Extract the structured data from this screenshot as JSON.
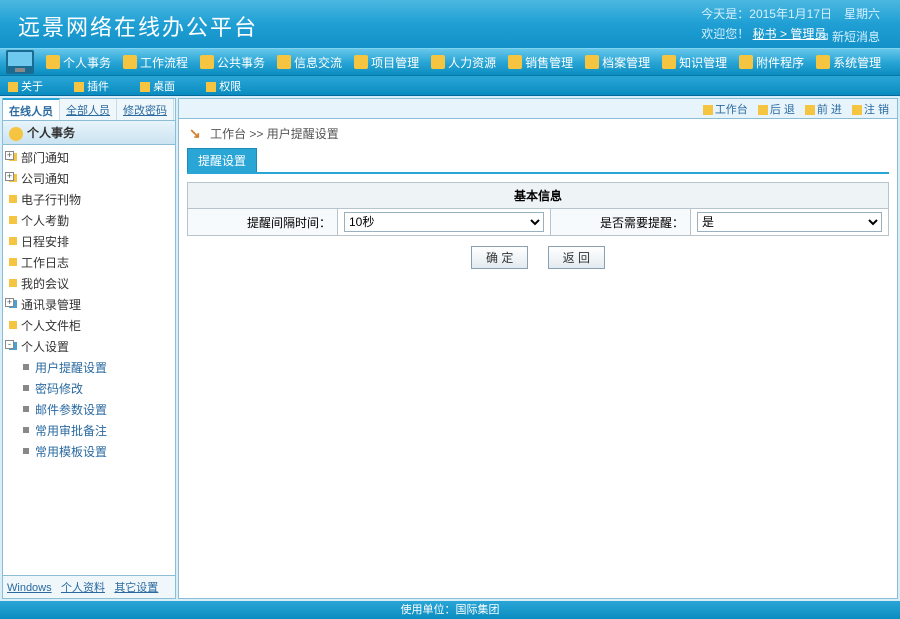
{
  "banner": {
    "title": "远景网络在线办公平台",
    "date_label": "今天是：2015年1月17日　星期六",
    "welcome_prefix": "欢迎您！",
    "user_role": "秘书 > 管理员",
    "new_msg": "新短消息"
  },
  "mainnav": [
    "个人事务",
    "工作流程",
    "公共事务",
    "信息交流",
    "项目管理",
    "人力资源",
    "销售管理",
    "档案管理",
    "知识管理",
    "附件程序",
    "系统管理"
  ],
  "subbar_left": [
    "关于",
    "插件",
    "桌面",
    "权限"
  ],
  "rightbar": [
    "工作台",
    "后 退",
    "前 进",
    "注 销"
  ],
  "side_tabs": [
    "在线人员",
    "全部人员",
    "修改密码"
  ],
  "side_head": "个人事务",
  "tree": [
    {
      "label": "部门通知",
      "type": "item"
    },
    {
      "label": "公司通知",
      "type": "item"
    },
    {
      "label": "电子行刊物",
      "type": "item"
    },
    {
      "label": "个人考勤",
      "type": "item"
    },
    {
      "label": "日程安排",
      "type": "item"
    },
    {
      "label": "工作日志",
      "type": "item"
    },
    {
      "label": "我的会议",
      "type": "item"
    },
    {
      "label": "通讯录管理",
      "type": "folder"
    },
    {
      "label": "个人文件柜",
      "type": "item"
    },
    {
      "label": "个人设置",
      "type": "folder",
      "expanded": true,
      "children": [
        "用户提醒设置",
        "密码修改",
        "邮件参数设置",
        "常用审批备注",
        "常用模板设置"
      ]
    }
  ],
  "side_bottom": [
    "Windows",
    "个人资料",
    "其它设置"
  ],
  "crumb": {
    "home": "工作台",
    "sep": " >> ",
    "page": "用户提醒设置"
  },
  "content_tab": "提醒设置",
  "table": {
    "header": "基本信息",
    "row1_label": "提醒间隔时间：",
    "row1_value": "10秒",
    "row2_label": "是否需要提醒：",
    "row2_value": "是"
  },
  "buttons": {
    "ok": "确  定",
    "back": "返  回"
  },
  "footer": "使用单位：国际集团"
}
